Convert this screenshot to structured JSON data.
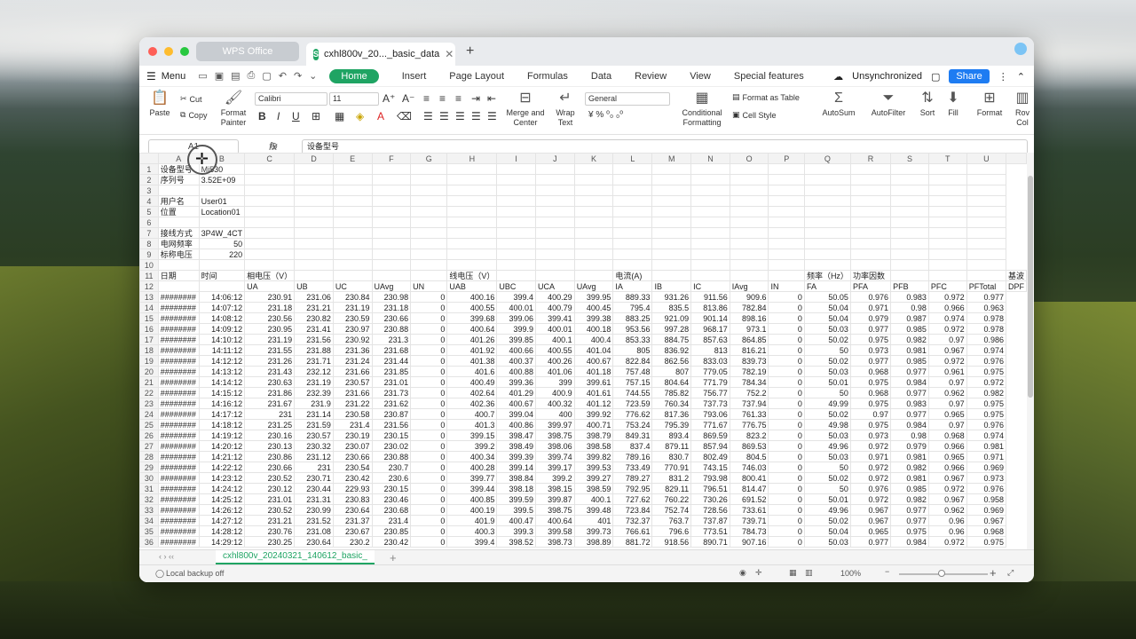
{
  "tabs": {
    "app": "WPS Office",
    "file": "cxhl800v_20..._basic_data"
  },
  "menu": {
    "label": "Menu",
    "ribbon_tabs": [
      "Home",
      "Insert",
      "Page Layout",
      "Formulas",
      "Data",
      "Review",
      "View",
      "Special features"
    ],
    "sync": "Unsynchronized",
    "share": "Share"
  },
  "ribbon": {
    "paste": "Paste",
    "cut": "Cut",
    "copy": "Copy",
    "format_painter_1": "Format",
    "format_painter_2": "Painter",
    "font": "Calibri",
    "size": "11",
    "merge_1": "Merge and",
    "merge_2": "Center",
    "wrap_1": "Wrap",
    "wrap_2": "Text",
    "number_format": "General",
    "cond_1": "Conditional",
    "cond_2": "Formatting",
    "format_table": "Format as Table",
    "cell_style": "Cell Style",
    "autosum": "AutoSum",
    "autofilter": "AutoFilter",
    "sort": "Sort",
    "fill": "Fill",
    "format": "Format",
    "rowcol_1": "Rov",
    "rowcol_2": "Col"
  },
  "formula": {
    "cell": "A1",
    "value": "设备型号"
  },
  "columns": [
    "A",
    "B",
    "C",
    "D",
    "E",
    "F",
    "G",
    "H",
    "I",
    "J",
    "K",
    "L",
    "M",
    "N",
    "O",
    "P",
    "Q",
    "R",
    "S",
    "T",
    "U",
    ""
  ],
  "rows": [
    [
      "1",
      "设备型号",
      "Mi530",
      "",
      "",
      "",
      "",
      "",
      "",
      "",
      "",
      "",
      "",
      "",
      "",
      "",
      "",
      "",
      "",
      "",
      "",
      ""
    ],
    [
      "2",
      "序列号",
      "3.52E+09",
      "",
      "",
      "",
      "",
      "",
      "",
      "",
      "",
      "",
      "",
      "",
      "",
      "",
      "",
      "",
      "",
      "",
      "",
      ""
    ],
    [
      "3",
      "",
      "",
      "",
      "",
      "",
      "",
      "",
      "",
      "",
      "",
      "",
      "",
      "",
      "",
      "",
      "",
      "",
      "",
      "",
      "",
      ""
    ],
    [
      "4",
      "用户名",
      "User01",
      "",
      "",
      "",
      "",
      "",
      "",
      "",
      "",
      "",
      "",
      "",
      "",
      "",
      "",
      "",
      "",
      "",
      "",
      ""
    ],
    [
      "5",
      "位置",
      "Location01",
      "",
      "",
      "",
      "",
      "",
      "",
      "",
      "",
      "",
      "",
      "",
      "",
      "",
      "",
      "",
      "",
      "",
      "",
      ""
    ],
    [
      "6",
      "",
      "",
      "",
      "",
      "",
      "",
      "",
      "",
      "",
      "",
      "",
      "",
      "",
      "",
      "",
      "",
      "",
      "",
      "",
      "",
      ""
    ],
    [
      "7",
      "接线方式",
      "3P4W_4CT",
      "",
      "",
      "",
      "",
      "",
      "",
      "",
      "",
      "",
      "",
      "",
      "",
      "",
      "",
      "",
      "",
      "",
      "",
      ""
    ],
    [
      "8",
      "电网频率",
      "50",
      "",
      "",
      "",
      "",
      "",
      "",
      "",
      "",
      "",
      "",
      "",
      "",
      "",
      "",
      "",
      "",
      "",
      "",
      ""
    ],
    [
      "9",
      "标称电压",
      "220",
      "",
      "",
      "",
      "",
      "",
      "",
      "",
      "",
      "",
      "",
      "",
      "",
      "",
      "",
      "",
      "",
      "",
      "",
      ""
    ],
    [
      "10",
      "",
      "",
      "",
      "",
      "",
      "",
      "",
      "",
      "",
      "",
      "",
      "",
      "",
      "",
      "",
      "",
      "",
      "",
      "",
      "",
      ""
    ],
    [
      "11",
      "日期",
      "时间",
      "相电压（V）",
      "",
      "",
      "",
      "",
      "线电压（V）",
      "",
      "",
      "",
      "电流(A)",
      "",
      "",
      "",
      "",
      "频率（Hz）",
      "功率因数",
      "",
      "",
      "",
      "基波"
    ],
    [
      "12",
      "",
      "",
      "UA",
      "UB",
      "UC",
      "UAvg",
      "UN",
      "UAB",
      "UBC",
      "UCA",
      "UAvg",
      "IA",
      "IB",
      "IC",
      "IAvg",
      "IN",
      "FA",
      "PFA",
      "PFB",
      "PFC",
      "PFTotal",
      "DPF"
    ],
    [
      "13",
      "########",
      "14:06:12",
      "230.91",
      "231.06",
      "230.84",
      "230.98",
      "0",
      "400.16",
      "399.4",
      "400.29",
      "399.95",
      "889.33",
      "931.26",
      "911.56",
      "909.6",
      "0",
      "50.05",
      "0.976",
      "0.983",
      "0.972",
      "0.977"
    ],
    [
      "14",
      "########",
      "14:07:12",
      "231.18",
      "231.21",
      "231.19",
      "231.18",
      "0",
      "400.55",
      "400.01",
      "400.79",
      "400.45",
      "795.4",
      "835.5",
      "813.86",
      "782.84",
      "0",
      "50.04",
      "0.971",
      "0.98",
      "0.966",
      "0.963"
    ],
    [
      "15",
      "########",
      "14:08:12",
      "230.56",
      "230.82",
      "230.59",
      "230.66",
      "0",
      "399.68",
      "399.06",
      "399.41",
      "399.38",
      "883.25",
      "921.09",
      "901.14",
      "898.16",
      "0",
      "50.04",
      "0.979",
      "0.987",
      "0.974",
      "0.978"
    ],
    [
      "16",
      "########",
      "14:09:12",
      "230.95",
      "231.41",
      "230.97",
      "230.88",
      "0",
      "400.64",
      "399.9",
      "400.01",
      "400.18",
      "953.56",
      "997.28",
      "968.17",
      "973.1",
      "0",
      "50.03",
      "0.977",
      "0.985",
      "0.972",
      "0.978"
    ],
    [
      "17",
      "########",
      "14:10:12",
      "231.19",
      "231.56",
      "230.92",
      "231.3",
      "0",
      "401.26",
      "399.85",
      "400.1",
      "400.4",
      "853.33",
      "884.75",
      "857.63",
      "864.85",
      "0",
      "50.02",
      "0.975",
      "0.982",
      "0.97",
      "0.986"
    ],
    [
      "18",
      "########",
      "14:11:12",
      "231.55",
      "231.88",
      "231.36",
      "231.68",
      "0",
      "401.92",
      "400.66",
      "400.55",
      "401.04",
      "805",
      "836.92",
      "813",
      "816.21",
      "0",
      "50",
      "0.973",
      "0.981",
      "0.967",
      "0.974"
    ],
    [
      "19",
      "########",
      "14:12:12",
      "231.26",
      "231.71",
      "231.24",
      "231.44",
      "0",
      "401.38",
      "400.37",
      "400.26",
      "400.67",
      "822.84",
      "862.56",
      "833.03",
      "839.73",
      "0",
      "50.02",
      "0.977",
      "0.985",
      "0.972",
      "0.976"
    ],
    [
      "20",
      "########",
      "14:13:12",
      "231.43",
      "232.12",
      "231.66",
      "231.85",
      "0",
      "401.6",
      "400.88",
      "401.06",
      "401.18",
      "757.48",
      "807",
      "779.05",
      "782.19",
      "0",
      "50.03",
      "0.968",
      "0.977",
      "0.961",
      "0.975"
    ],
    [
      "21",
      "########",
      "14:14:12",
      "230.63",
      "231.19",
      "230.57",
      "231.01",
      "0",
      "400.49",
      "399.36",
      "399",
      "399.61",
      "757.15",
      "804.64",
      "771.79",
      "784.34",
      "0",
      "50.01",
      "0.975",
      "0.984",
      "0.97",
      "0.972"
    ],
    [
      "22",
      "########",
      "14:15:12",
      "231.86",
      "232.39",
      "231.66",
      "231.73",
      "0",
      "402.64",
      "401.29",
      "400.9",
      "401.61",
      "744.55",
      "785.82",
      "756.77",
      "752.2",
      "0",
      "50",
      "0.968",
      "0.977",
      "0.962",
      "0.982"
    ],
    [
      "23",
      "########",
      "14:16:12",
      "231.67",
      "231.9",
      "231.22",
      "231.62",
      "0",
      "402.36",
      "400.67",
      "400.32",
      "401.12",
      "723.59",
      "760.34",
      "737.73",
      "737.94",
      "0",
      "49.99",
      "0.975",
      "0.983",
      "0.97",
      "0.975"
    ],
    [
      "24",
      "########",
      "14:17:12",
      "231",
      "231.14",
      "230.58",
      "230.87",
      "0",
      "400.7",
      "399.04",
      "400",
      "399.92",
      "776.62",
      "817.36",
      "793.06",
      "761.33",
      "0",
      "50.02",
      "0.97",
      "0.977",
      "0.965",
      "0.975"
    ],
    [
      "25",
      "########",
      "14:18:12",
      "231.25",
      "231.59",
      "231.4",
      "231.56",
      "0",
      "401.3",
      "400.86",
      "399.97",
      "400.71",
      "753.24",
      "795.39",
      "771.67",
      "776.75",
      "0",
      "49.98",
      "0.975",
      "0.984",
      "0.97",
      "0.976"
    ],
    [
      "26",
      "########",
      "14:19:12",
      "230.16",
      "230.57",
      "230.19",
      "230.15",
      "0",
      "399.15",
      "398.47",
      "398.75",
      "398.79",
      "849.31",
      "893.4",
      "869.59",
      "823.2",
      "0",
      "50.03",
      "0.973",
      "0.98",
      "0.968",
      "0.974"
    ],
    [
      "27",
      "########",
      "14:20:12",
      "230.13",
      "230.32",
      "230.07",
      "230.02",
      "0",
      "399.2",
      "398.49",
      "398.06",
      "398.58",
      "837.4",
      "879.11",
      "857.94",
      "869.53",
      "0",
      "49.96",
      "0.972",
      "0.979",
      "0.966",
      "0.981"
    ],
    [
      "28",
      "########",
      "14:21:12",
      "230.86",
      "231.12",
      "230.66",
      "230.88",
      "0",
      "400.34",
      "399.39",
      "399.74",
      "399.82",
      "789.16",
      "830.7",
      "802.49",
      "804.5",
      "0",
      "50.03",
      "0.971",
      "0.981",
      "0.965",
      "0.971"
    ],
    [
      "29",
      "########",
      "14:22:12",
      "230.66",
      "231",
      "230.54",
      "230.7",
      "0",
      "400.28",
      "399.14",
      "399.17",
      "399.53",
      "733.49",
      "770.91",
      "743.15",
      "746.03",
      "0",
      "50",
      "0.972",
      "0.982",
      "0.966",
      "0.969"
    ],
    [
      "30",
      "########",
      "14:23:12",
      "230.52",
      "230.71",
      "230.42",
      "230.6",
      "0",
      "399.77",
      "398.84",
      "399.2",
      "399.27",
      "789.27",
      "831.2",
      "793.98",
      "800.41",
      "0",
      "50.02",
      "0.972",
      "0.981",
      "0.967",
      "0.973"
    ],
    [
      "31",
      "########",
      "14:24:12",
      "230.12",
      "230.44",
      "229.93",
      "230.15",
      "0",
      "399.44",
      "398.18",
      "398.15",
      "398.59",
      "792.95",
      "829.11",
      "796.51",
      "814.47",
      "0",
      "50",
      "0.976",
      "0.985",
      "0.972",
      "0.976"
    ],
    [
      "32",
      "########",
      "14:25:12",
      "231.01",
      "231.31",
      "230.83",
      "230.46",
      "0",
      "400.85",
      "399.59",
      "399.87",
      "400.1",
      "727.62",
      "760.22",
      "730.26",
      "691.52",
      "0",
      "50.01",
      "0.972",
      "0.982",
      "0.967",
      "0.958"
    ],
    [
      "33",
      "########",
      "14:26:12",
      "230.52",
      "230.99",
      "230.64",
      "230.68",
      "0",
      "400.19",
      "399.5",
      "398.75",
      "399.48",
      "723.84",
      "752.74",
      "728.56",
      "733.61",
      "0",
      "49.96",
      "0.967",
      "0.977",
      "0.962",
      "0.969"
    ],
    [
      "34",
      "########",
      "14:27:12",
      "231.21",
      "231.52",
      "231.37",
      "231.4",
      "0",
      "401.9",
      "400.47",
      "400.64",
      "401",
      "732.37",
      "763.7",
      "737.87",
      "739.71",
      "0",
      "50.02",
      "0.967",
      "0.977",
      "0.96",
      "0.967"
    ],
    [
      "35",
      "########",
      "14:28:12",
      "230.76",
      "231.08",
      "230.67",
      "230.85",
      "0",
      "400.3",
      "399.3",
      "399.58",
      "399.73",
      "766.61",
      "796.6",
      "773.51",
      "784.73",
      "0",
      "50.04",
      "0.965",
      "0.975",
      "0.96",
      "0.968"
    ],
    [
      "36",
      "########",
      "14:29:12",
      "230.25",
      "230.64",
      "230.2",
      "230.42",
      "0",
      "399.4",
      "398.52",
      "398.73",
      "398.89",
      "881.72",
      "918.56",
      "890.71",
      "907.16",
      "0",
      "50.03",
      "0.977",
      "0.984",
      "0.972",
      "0.975"
    ]
  ],
  "sheet": {
    "name": "cxhl800v_20240321_140612_basic_"
  },
  "status": {
    "backup": "Local backup off",
    "zoom": "100%"
  }
}
